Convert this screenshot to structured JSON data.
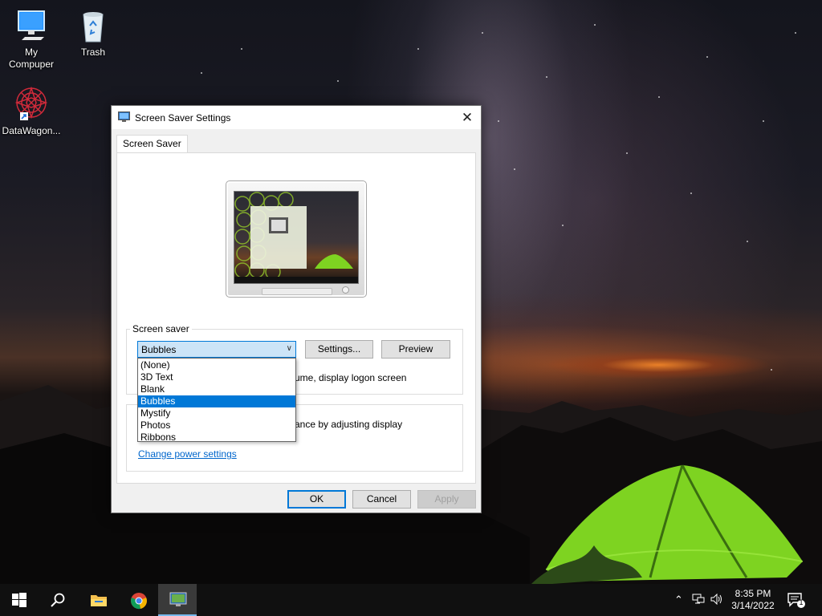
{
  "desktop": {
    "icons": [
      {
        "label": "My\nCompuper",
        "icon": "computer-icon"
      },
      {
        "label": "Trash",
        "icon": "recycle-bin-icon"
      },
      {
        "label": "DataWagon...",
        "icon": "datawagon-app-icon"
      }
    ]
  },
  "dialog": {
    "title": "Screen Saver Settings",
    "close_glyph": "✕",
    "tab": "Screen Saver",
    "screen_saver_group_label": "Screen saver",
    "selected_saver": "Bubbles",
    "settings_button": "Settings...",
    "preview_button": "Preview",
    "resume_text_partial": "ume, display logon screen",
    "power_text_partial": "ance by adjusting display",
    "power_link": "Change power settings",
    "ok_button": "OK",
    "cancel_button": "Cancel",
    "apply_button": "Apply",
    "dropdown_options": [
      "(None)",
      "3D Text",
      "Blank",
      "Bubbles",
      "Mystify",
      "Photos",
      "Ribbons"
    ],
    "dropdown_selected_index": 3
  },
  "taskbar": {
    "apps": [
      "start-icon",
      "search-icon",
      "file-explorer-icon",
      "chrome-icon",
      "screen-saver-settings-icon"
    ],
    "active_app": "screen-saver-settings-icon",
    "clock_time": "8:35 PM",
    "clock_date": "3/14/2022",
    "notification_count": "1"
  },
  "colors": {
    "accent": "#0078d7",
    "link": "#0066cc",
    "combo_bg": "#cce4f7"
  }
}
